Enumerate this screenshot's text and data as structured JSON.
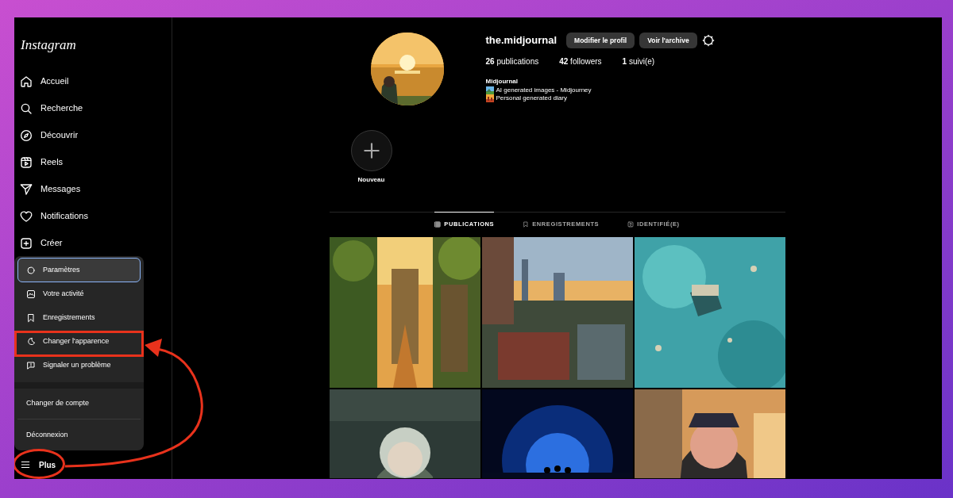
{
  "sidebar": {
    "logo": "Instagram",
    "items": [
      {
        "label": "Accueil"
      },
      {
        "label": "Recherche"
      },
      {
        "label": "Découvrir"
      },
      {
        "label": "Reels"
      },
      {
        "label": "Messages"
      },
      {
        "label": "Notifications"
      },
      {
        "label": "Créer"
      }
    ],
    "more": {
      "label": "Plus",
      "highlighted": true
    }
  },
  "menu": {
    "items": [
      {
        "label": "Paramètres",
        "selected": true,
        "highlighted": false
      },
      {
        "label": "Votre activité",
        "selected": false,
        "highlighted": false
      },
      {
        "label": "Enregistrements",
        "selected": false,
        "highlighted": false
      },
      {
        "label": "Changer l'apparence",
        "selected": false,
        "highlighted": true
      },
      {
        "label": "Signaler un problème",
        "selected": false,
        "highlighted": false
      }
    ],
    "account_items": [
      {
        "label": "Changer de compte"
      },
      {
        "label": "Déconnexion"
      }
    ]
  },
  "profile": {
    "username": "the.midjournal",
    "buttons": [
      "Modifier le profil",
      "Voir l'archive"
    ],
    "stats": [
      "**26** publications",
      "**42** followers",
      "**1** suivi(e)"
    ],
    "bio_name": "Midjournal",
    "bio_lines": [
      "AI generated images - Midjourney",
      "Personal generated diary"
    ],
    "story": {
      "label": "Nouveau"
    }
  },
  "tabs": [
    {
      "label": "PUBLICATIONS",
      "selected": true
    },
    {
      "label": "ENREGISTREMENTS",
      "selected": false
    },
    {
      "label": "IDENTIFIÉ(E)",
      "selected": false
    }
  ]
}
